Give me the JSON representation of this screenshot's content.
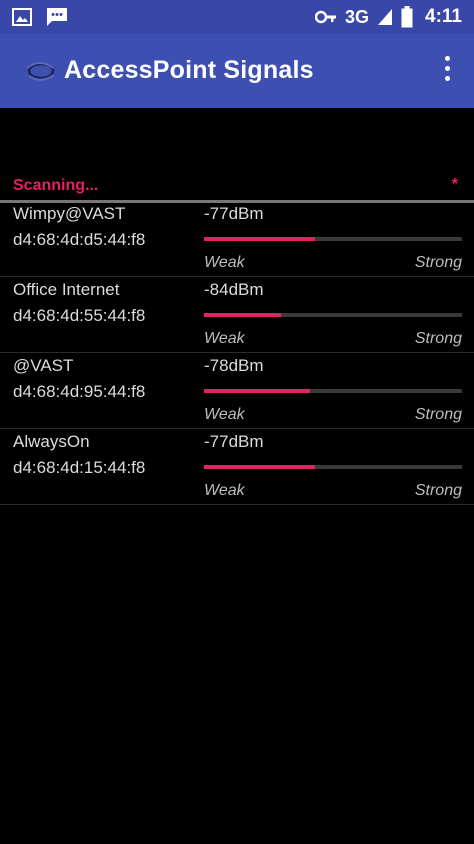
{
  "status_bar": {
    "left_icons": [
      "image-icon",
      "chat-message-icon"
    ],
    "right_icons": [
      "key-icon",
      "cell-signal-icon",
      "battery-icon"
    ],
    "network_type": "3G",
    "time": "4:11"
  },
  "app_bar": {
    "title": "AccessPoint Signals",
    "app_icon": "wifi-antenna-icon",
    "menu_icon": "overflow-menu-icon",
    "background_color": "#3d4fb0"
  },
  "scan": {
    "status_label": "Scanning...",
    "indicator": "*",
    "accent_color": "#e91e63"
  },
  "access_points": [
    {
      "ssid": "Wimpy@VAST",
      "mac": "d4:68:4d:d5:44:f8",
      "signal": "-77dBm",
      "strength_fraction": 0.43,
      "weak_label": "Weak",
      "strong_label": "Strong"
    },
    {
      "ssid": "Office Internet",
      "mac": "d4:68:4d:55:44:f8",
      "signal": "-84dBm",
      "strength_fraction": 0.3,
      "weak_label": "Weak",
      "strong_label": "Strong"
    },
    {
      "ssid": "@VAST",
      "mac": "d4:68:4d:95:44:f8",
      "signal": "-78dBm",
      "strength_fraction": 0.41,
      "weak_label": "Weak",
      "strong_label": "Strong"
    },
    {
      "ssid": "AlwaysOn",
      "mac": "d4:68:4d:15:44:f8",
      "signal": "-77dBm",
      "strength_fraction": 0.43,
      "weak_label": "Weak",
      "strong_label": "Strong"
    }
  ]
}
